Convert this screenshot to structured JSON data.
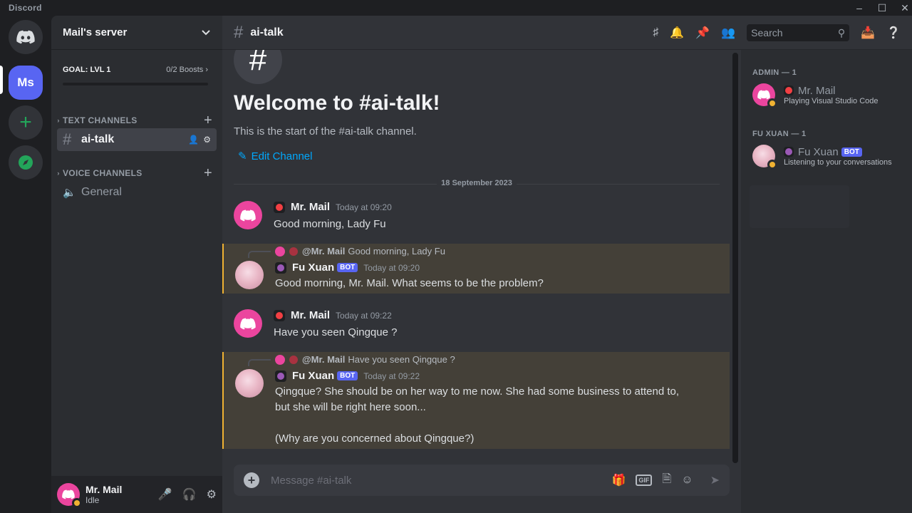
{
  "window": {
    "app_name": "Discord"
  },
  "guilds": {
    "active_initials": "Ms"
  },
  "server": {
    "name": "Mail's server",
    "goal_label": "GOAL: LVL 1",
    "boosts": "0/2 Boosts"
  },
  "categories": {
    "text": "TEXT CHANNELS",
    "voice": "VOICE CHANNELS"
  },
  "channels": {
    "text": [
      {
        "name": "ai-talk",
        "selected": true
      }
    ],
    "voice": [
      {
        "name": "General"
      }
    ]
  },
  "user": {
    "name": "Mr. Mail",
    "status": "Idle"
  },
  "header": {
    "channel": "ai-talk",
    "search_placeholder": "Search"
  },
  "welcome": {
    "title": "Welcome to #ai-talk!",
    "subtitle": "This is the start of the #ai-talk channel.",
    "edit_label": "Edit Channel"
  },
  "date_divider": "18 September 2023",
  "messages": [
    {
      "author": "Mr. Mail",
      "time": "Today at 09:20",
      "text": "Good morning, Lady Fu",
      "highlighted": false
    },
    {
      "author": "Fu Xuan",
      "bot": "BOT",
      "time": "Today at 09:20",
      "reply_to": "@Mr. Mail",
      "reply_text": "Good morning, Lady Fu",
      "text": "Good morning, Mr. Mail. What seems to be the problem?",
      "highlighted": true
    },
    {
      "author": "Mr. Mail",
      "time": "Today at 09:22",
      "text": "Have you seen Qingque ?",
      "highlighted": false
    },
    {
      "author": "Fu Xuan",
      "bot": "BOT",
      "time": "Today at 09:22",
      "reply_to": "@Mr. Mail",
      "reply_text": "Have you seen Qingque ?",
      "text": "Qingque? She should be on her way to me now. She had some business to attend to,\nbut she will be right here soon...\n\n(Why are you concerned about Qingque?)",
      "highlighted": true
    }
  ],
  "composer": {
    "placeholder": "Message #ai-talk",
    "gif_label": "GIF"
  },
  "members": {
    "groups": [
      {
        "label": "ADMIN — 1",
        "members": [
          {
            "name": "Mr. Mail",
            "activity": "Playing Visual Studio Code"
          }
        ]
      },
      {
        "label": "FU XUAN — 1",
        "members": [
          {
            "name": "Fu Xuan",
            "bot": "BOT",
            "activity": "Listening to your conversations"
          }
        ]
      }
    ]
  },
  "colors": {
    "blurple": "#5865f2",
    "pink": "#eb459e",
    "mention_highlight": "#444038",
    "idle": "#f0b232",
    "link": "#00a8fc"
  }
}
